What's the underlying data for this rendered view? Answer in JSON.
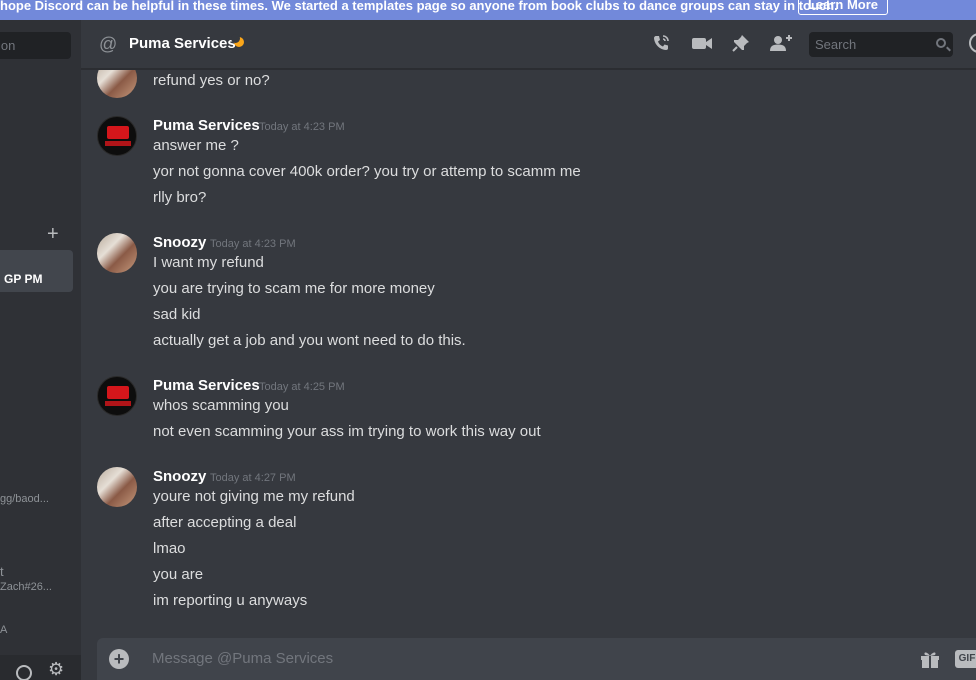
{
  "banner": {
    "text": "hope Discord can be helpful in these times. We started a templates page so anyone from book clubs to dance groups can stay in touch.",
    "button": "Learn More"
  },
  "sidebar": {
    "search_placeholder": "ion",
    "add": "+",
    "active_dm": "GP PM",
    "dm_entries": [
      "gg/baod...",
      "t",
      "Zach#26...",
      "A"
    ]
  },
  "header": {
    "channel": "Puma Services",
    "search_placeholder": "Search",
    "icons": [
      "at-icon",
      "call-icon",
      "video-icon",
      "pin-icon",
      "add-friend-icon",
      "search-icon",
      "help-icon"
    ]
  },
  "messages": {
    "orphan": [
      "refund yes or no?"
    ],
    "groups": [
      {
        "author": "Puma Services",
        "timestamp": "Today at 4:23 PM",
        "lines": [
          "answer me ?",
          "yor not gonna cover 400k order? you try or attemp to scamm me",
          "rlly bro?"
        ]
      },
      {
        "author": "Snoozy",
        "timestamp": "Today at 4:23 PM",
        "lines": [
          "I want my refund",
          "you are trying to scam me for more money",
          "sad kid",
          "actually get a job and you wont need to do this."
        ]
      },
      {
        "author": "Puma Services",
        "timestamp": "Today at 4:25 PM",
        "lines": [
          "whos scamming you",
          "not even scamming your ass im trying to work this way out"
        ]
      },
      {
        "author": "Snoozy",
        "timestamp": "Today at 4:27 PM",
        "lines": [
          "youre not giving me my refund",
          "after accepting a deal",
          "lmao",
          "you are",
          "im reporting u anyways"
        ]
      }
    ]
  },
  "composer": {
    "placeholder": "Message @Puma Services",
    "gif_label": "GIF"
  }
}
